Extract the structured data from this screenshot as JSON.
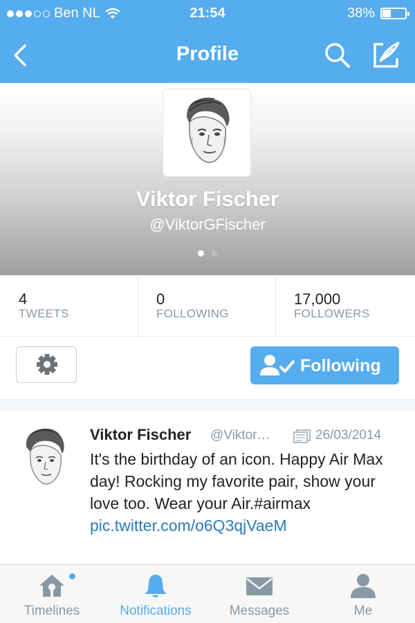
{
  "status_bar": {
    "carrier": "Ben NL",
    "time": "21:54",
    "battery_text": "38%",
    "battery_level": 0.38,
    "signal_dots_filled": 3,
    "signal_dots_total": 5
  },
  "nav": {
    "title": "Profile",
    "icons": {
      "back": "chevron-left-icon",
      "search": "search-icon",
      "compose": "compose-icon"
    }
  },
  "profile": {
    "name": "Viktor Fischer",
    "handle": "@ViktorGFischer",
    "pages_total": 2,
    "active_page": 1
  },
  "stats": [
    {
      "value": "4",
      "label": "TWEETS"
    },
    {
      "value": "0",
      "label": "FOLLOWING"
    },
    {
      "value": "17,000",
      "label": "FOLLOWERS"
    }
  ],
  "actions": {
    "settings_icon": "gear-icon",
    "following_label": "Following",
    "following_icon": "user-check-icon"
  },
  "tweet": {
    "name": "Viktor Fischer",
    "handle": "@Viktor…",
    "date": "26/03/2014",
    "text": "It's the birthday of an icon. Happy Air Max day! Rocking my favorite pair, show your love too. Wear your Air.#airmax ",
    "link": "pic.twitter.com/o6Q3qjVaeM"
  },
  "tabs": [
    {
      "label": "Timelines",
      "icon": "home-icon",
      "active": false
    },
    {
      "label": "Notifications",
      "icon": "bell-icon",
      "active": true
    },
    {
      "label": "Messages",
      "icon": "envelope-icon",
      "active": false
    },
    {
      "label": "Me",
      "icon": "person-icon",
      "active": false
    }
  ],
  "colors": {
    "brand": "#55acee",
    "muted_text": "#8899a6",
    "link": "#2b7bb9"
  }
}
